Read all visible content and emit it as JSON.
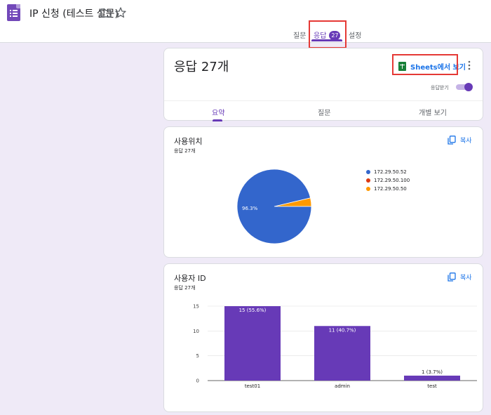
{
  "header": {
    "title": "IP 신청 (테스트 설문)",
    "tabs": [
      {
        "label": "질문"
      },
      {
        "label": "응답",
        "badge": "27"
      },
      {
        "label": "설정"
      }
    ]
  },
  "summary_card": {
    "title": "응답 27개",
    "sheets_label": "Sheets에서 보기",
    "toggle_label": "응답받기",
    "accepting_responses": true,
    "subtabs": [
      {
        "label": "요약"
      },
      {
        "label": "질문"
      },
      {
        "label": "개별 보기"
      }
    ]
  },
  "questions": [
    {
      "title": "사용위치",
      "count": "응답 27개",
      "copy_label": "복사",
      "chart_data": {
        "type": "pie",
        "labels": [
          "172.29.50.52",
          "172.29.50.100",
          "172.29.50.50"
        ],
        "values": [
          26,
          0,
          1
        ],
        "slice_label": "96.3%",
        "colors": [
          "#3366cc",
          "#dc3912",
          "#ff9900"
        ]
      }
    },
    {
      "title": "사용자 ID",
      "count": "응답 27개",
      "copy_label": "복사",
      "chart_data": {
        "type": "bar",
        "categories": [
          "test01",
          "admin",
          "test"
        ],
        "values": [
          15,
          11,
          1
        ],
        "data_labels": [
          "15 (55.6%)",
          "11 (40.7%)",
          "1 (3.7%)"
        ],
        "yticks": [
          "15",
          "10",
          "5",
          "0"
        ],
        "ylim": [
          0,
          15
        ],
        "color": "#673ab7"
      }
    }
  ],
  "colors": {
    "accent": "#673ab7",
    "link": "#1a73e8",
    "highlight_box": "#e53935",
    "background": "#efeaf7"
  }
}
